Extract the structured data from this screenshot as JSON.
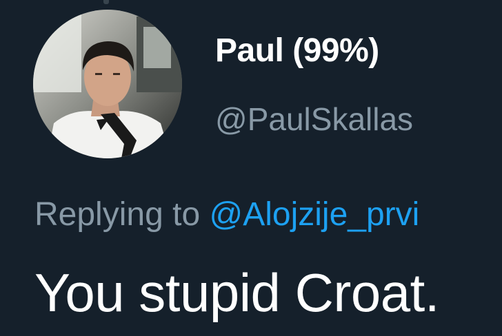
{
  "tweet": {
    "author": {
      "display_name": "Paul (99%)",
      "handle": "@PaulSkallas"
    },
    "reply": {
      "prefix": "Replying to",
      "mention": "@Alojzije_prvi"
    },
    "text": "You stupid Croat."
  },
  "colors": {
    "background": "#15202b",
    "primary_text": "#ffffff",
    "secondary_text": "#8899a6",
    "link": "#1da1f2"
  }
}
